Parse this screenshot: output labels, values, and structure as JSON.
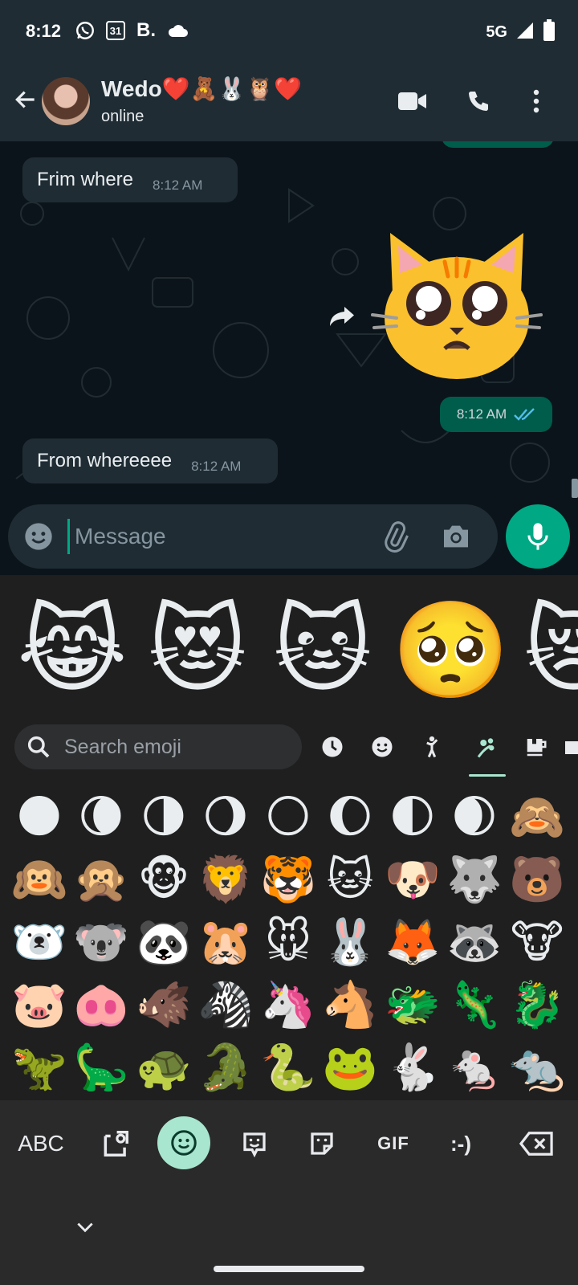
{
  "status_bar": {
    "time": "8:12",
    "calendar_day": "31",
    "b_label": "B.",
    "network": "5G"
  },
  "header": {
    "contact_name": "Wedo❤️🧸🐰🦉❤️",
    "contact_status": "online"
  },
  "messages": [
    {
      "direction": "in",
      "text": "Frim where",
      "time": "8:12 AM"
    },
    {
      "direction": "out",
      "sticker": "🥺🐱",
      "time": "8:12 AM",
      "status": "read"
    },
    {
      "direction": "in",
      "text": "From whereeee",
      "time": "8:12 AM"
    }
  ],
  "composer": {
    "placeholder": "Message"
  },
  "emoji_keyboard": {
    "suggestions": [
      "😹",
      "😻",
      "🐱",
      "🥺",
      "😿"
    ],
    "search_placeholder": "Search emoji",
    "categories": [
      "recent",
      "smileys",
      "people",
      "animals-nature",
      "food-drink",
      "objects"
    ],
    "active_category": "animals-nature",
    "grid": [
      [
        "🌑",
        "🌘",
        "🌗",
        "🌖",
        "🌕",
        "🌔",
        "🌓",
        "🌒",
        "🙈"
      ],
      [
        "🙉",
        "🙊",
        "🐵",
        "🦁",
        "🐯",
        "🐱",
        "🐶",
        "🐺",
        "🐻"
      ],
      [
        "🐻‍❄️",
        "🐨",
        "🐼",
        "🐹",
        "🐭",
        "🐰",
        "🦊",
        "🦝",
        "🐮"
      ],
      [
        "🐷",
        "🐽",
        "🐗",
        "🦓",
        "🦄",
        "🐴",
        "🐲",
        "🦎",
        "🐉"
      ],
      [
        "🦖",
        "🦕",
        "🐢",
        "🐊",
        "🐍",
        "🐸",
        "🐇",
        "🐁",
        "🐀"
      ]
    ],
    "toolbar": {
      "abc_label": "ABC",
      "gif_label": "GIF",
      "emoticon_label": ":-)"
    }
  }
}
